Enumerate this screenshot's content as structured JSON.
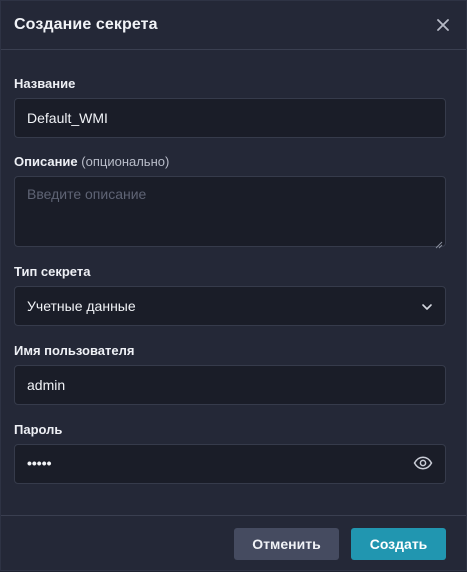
{
  "dialog": {
    "title": "Создание секрета"
  },
  "form": {
    "name_label": "Название",
    "name_value": "Default_WMI",
    "description_label": "Описание",
    "description_optional": "(опционально)",
    "description_placeholder": "Введите описание",
    "type_label": "Тип секрета",
    "type_value": "Учетные данные",
    "username_label": "Имя пользователя",
    "username_value": "admin",
    "password_label": "Пароль",
    "password_masked": "•••••"
  },
  "footer": {
    "cancel_label": "Отменить",
    "create_label": "Создать"
  },
  "icons": {
    "close": "close-icon",
    "dropdown": "chevron-down-icon",
    "show_password": "eye-icon",
    "resize": "resize-handle-icon"
  },
  "colors": {
    "accent": "#2196b0",
    "background": "#242837",
    "field_background": "#1a1d28",
    "secondary_button": "#454b60"
  }
}
